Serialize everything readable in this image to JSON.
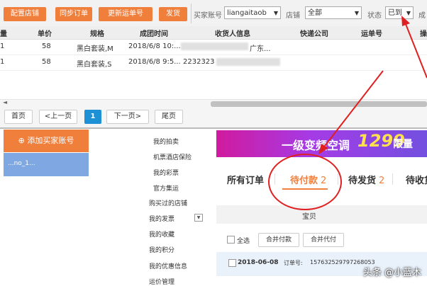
{
  "toolbar": {
    "buttons": [
      "配置店铺",
      "同步订单",
      "更新运单号",
      "发货"
    ],
    "buyer_label": "买家账号",
    "buyer_value": "liangaitaob",
    "store_label": "店铺",
    "store_value": "全部",
    "status_label": "状态",
    "status_value": "已到",
    "tail": "成"
  },
  "table": {
    "headers": [
      "量",
      "单价",
      "规格",
      "成团时间",
      "收货人信息",
      "快递公司",
      "运单号",
      "操"
    ],
    "rows": [
      {
        "qty": "1",
        "price": "58",
        "spec": "黑白套装,M",
        "time": "2018/6/8 10:...",
        "receiver": "广东..."
      },
      {
        "qty": "1",
        "price": "58",
        "spec": "黑白套装,S",
        "time": "2018/6/8 9:5...",
        "receiver": "2232323"
      }
    ]
  },
  "pager": {
    "first": "首页",
    "prev": "<上一页",
    "current": "1",
    "next": "下一页>",
    "last": "尾页"
  },
  "buyer_panel": {
    "add_label": "添加买家账号",
    "account": "...no_1..."
  },
  "menu": [
    "我的拍卖",
    "机票酒店保险",
    "我的彩票",
    "官方集运",
    "购买过的店铺",
    "我的发票",
    "我的收藏",
    "我的积分",
    "我的优惠信息",
    "运价管理"
  ],
  "banner": {
    "text1": "一级变频空调",
    "price": "1299",
    "text2": "限量"
  },
  "tabs": [
    {
      "label": "所有订单",
      "count": ""
    },
    {
      "label": "待付款",
      "count": "2"
    },
    {
      "label": "待发货",
      "count": "2"
    },
    {
      "label": "待收货",
      "count": ""
    }
  ],
  "order_list": {
    "column": "宝贝",
    "select_all": "全选",
    "merge_pay": "合并付款",
    "merge_proxy": "合并代付",
    "order_date": "2018-06-08",
    "order_no_label": "订单号:",
    "order_no": "157632529797268053"
  },
  "watermark": "头条 @小蓝木",
  "colors": {
    "accent": "#f07f3c",
    "highlight": "#e02020",
    "page_blue": "#1e90d6"
  }
}
